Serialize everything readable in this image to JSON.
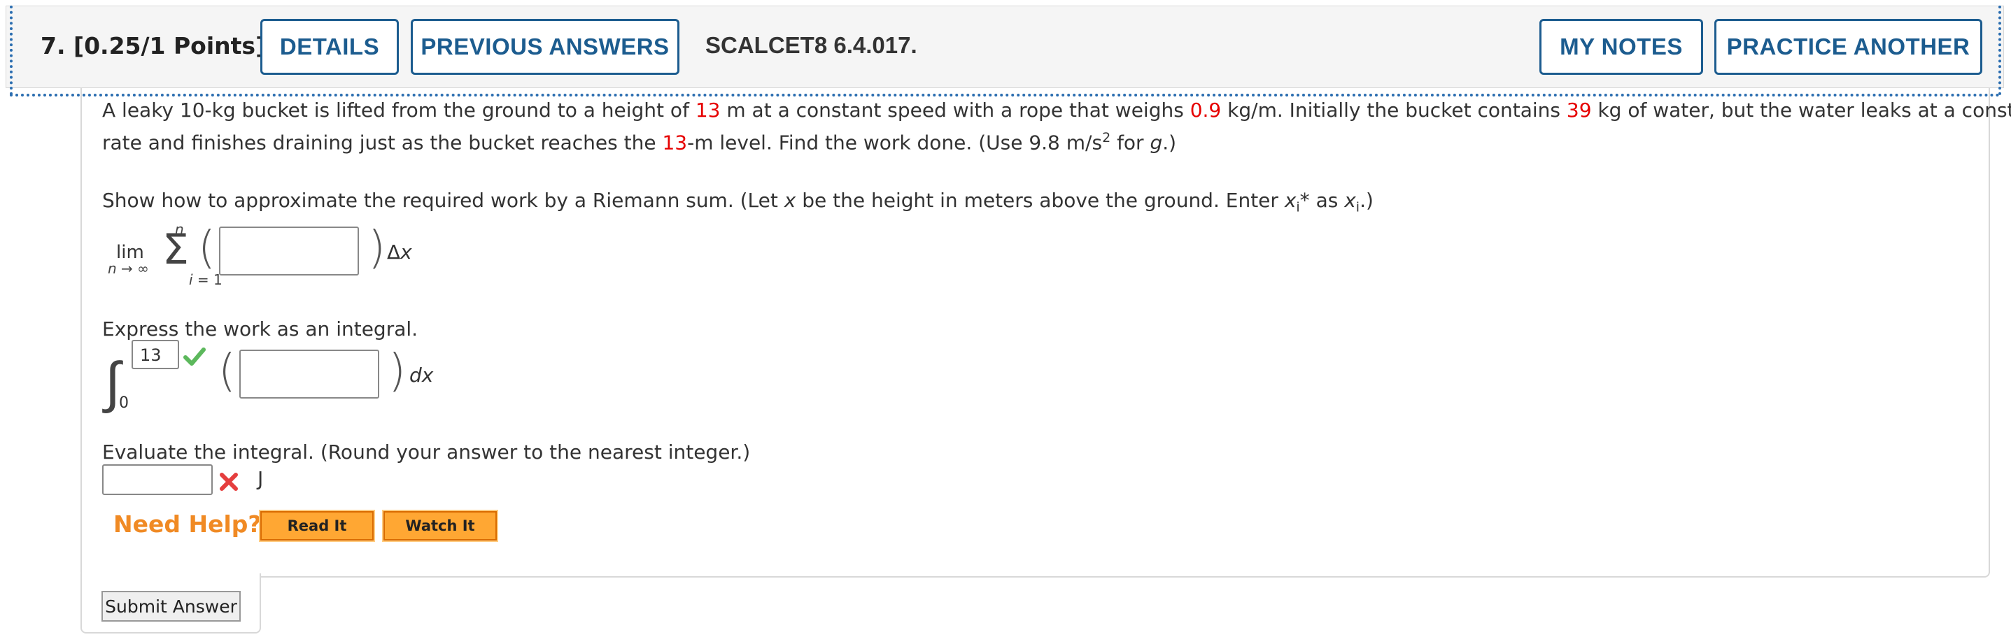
{
  "header": {
    "question_label": "7.  [0.25/1 Points]",
    "details_label": "DETAILS",
    "previous_answers_label": "PREVIOUS ANSWERS",
    "code_label": "SCALCET8 6.4.017.",
    "my_notes_label": "MY NOTES",
    "practice_another_label": "PRACTICE ANOTHER"
  },
  "problem": {
    "line1_a": "A leaky 10-kg bucket is lifted from the ground to a height of ",
    "line1_height": "13",
    "line1_b": " m at a constant speed with a rope that weighs ",
    "line1_rope": "0.9",
    "line1_c": " kg/m. Initially the bucket contains ",
    "line1_water": "39",
    "line1_d": " kg of water, but the water leaks at a constant",
    "line2_a": "rate and finishes draining just as the bucket reaches the ",
    "line2_height": "13",
    "line2_b": "-m level. Find the work done. (Use 9.8 m/s",
    "line2_sup": "2",
    "line2_c": " for ",
    "line2_g": "g",
    "line2_d": ".)"
  },
  "riemann": {
    "prompt_a": "Show how to approximate the required work by a Riemann sum. (Let ",
    "prompt_x": "x",
    "prompt_b": " be the height in meters above the ground. Enter ",
    "prompt_xi": "x",
    "prompt_sub1": "i",
    "prompt_star": "*",
    "prompt_c": " as ",
    "prompt_xi2": "x",
    "prompt_sub2": "i",
    "prompt_d": ".)",
    "lim_label": "lim",
    "lim_sub": "n → ∞",
    "sigma_top": "n",
    "sigma_bottom": "i = 1",
    "sigma_symbol": "Σ",
    "delta_label": "Δx",
    "input_value": ""
  },
  "integral": {
    "prompt": "Express the work as an integral.",
    "upper_value": "13",
    "lower_value": "0",
    "integral_symbol": "∫",
    "dx_label": "dx",
    "input_value": ""
  },
  "evaluate": {
    "prompt": "Evaluate the integral. (Round your answer to the nearest integer.)",
    "input_value": "",
    "unit": "J"
  },
  "help": {
    "label": "Need Help?",
    "read_it": "Read It",
    "watch_it": "Watch It"
  },
  "submit_label": "Submit Answer",
  "colors": {
    "brand": "#1c5c8f",
    "red_value": "#e60000",
    "help_orange": "#f08a24",
    "check_green": "#5cb85c",
    "x_red": "#e53e3e"
  }
}
